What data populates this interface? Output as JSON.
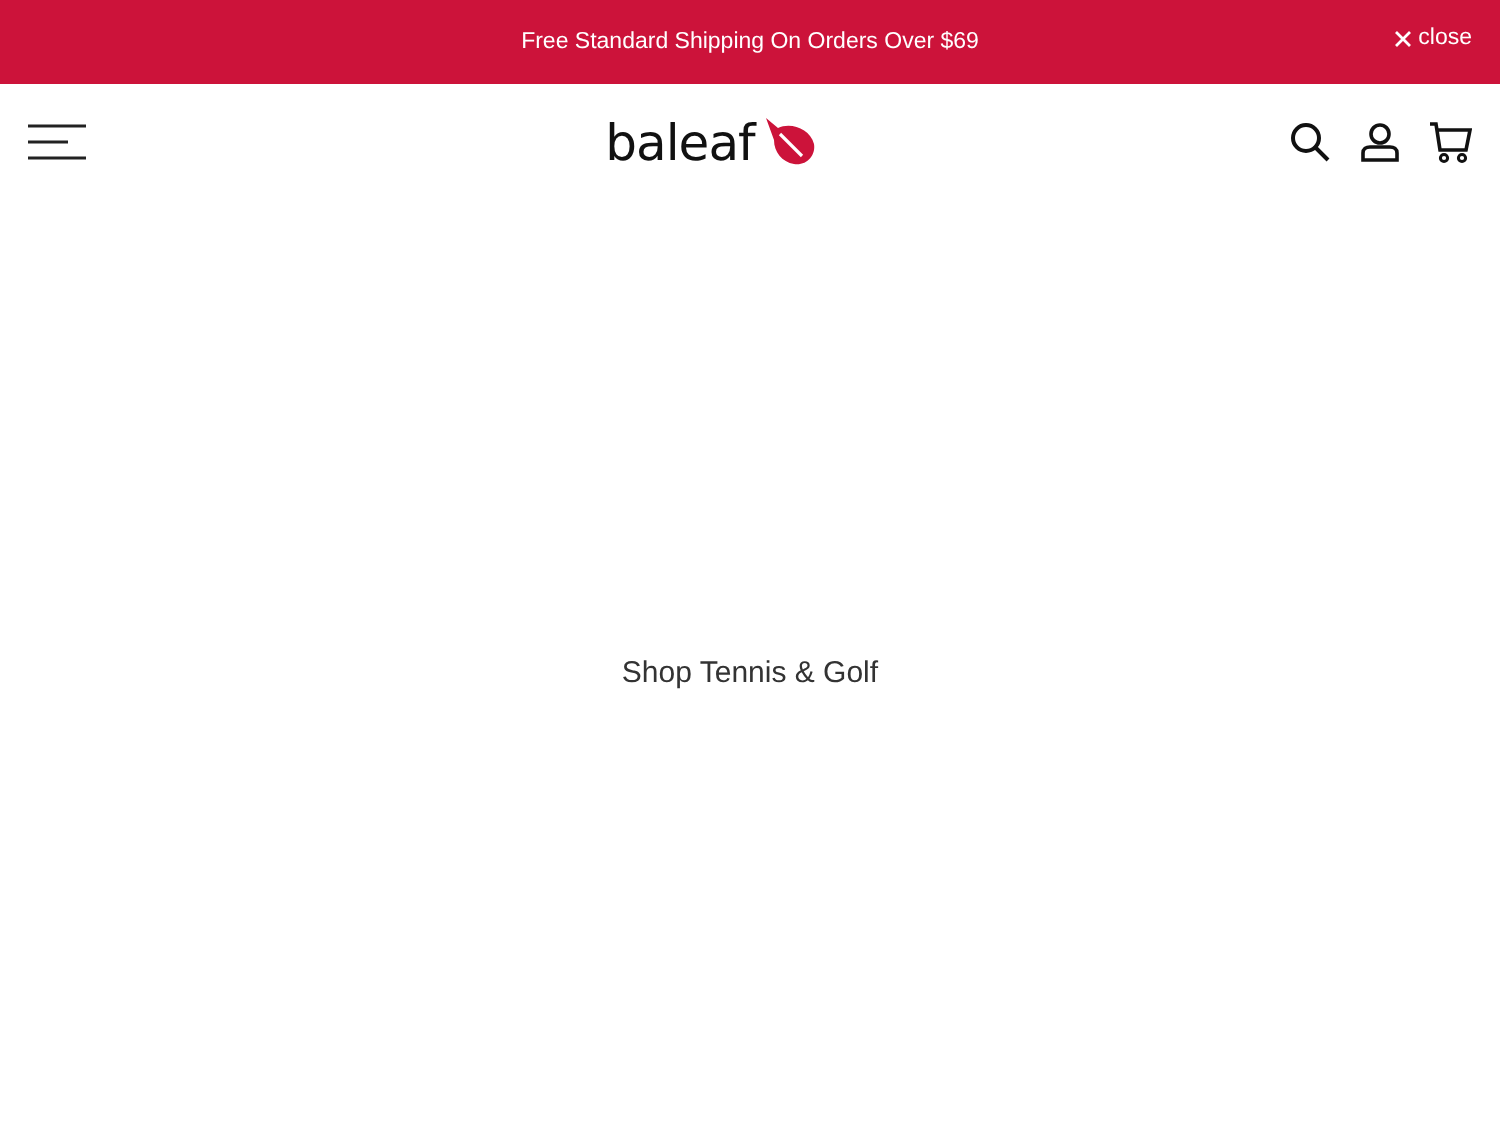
{
  "announcement_bar": {
    "text": "Free Standard Shipping On Orders Over $69",
    "close_label": "close"
  },
  "header": {
    "logo": "baleaf"
  },
  "main": {
    "link": "Shop Tennis & Golf"
  }
}
